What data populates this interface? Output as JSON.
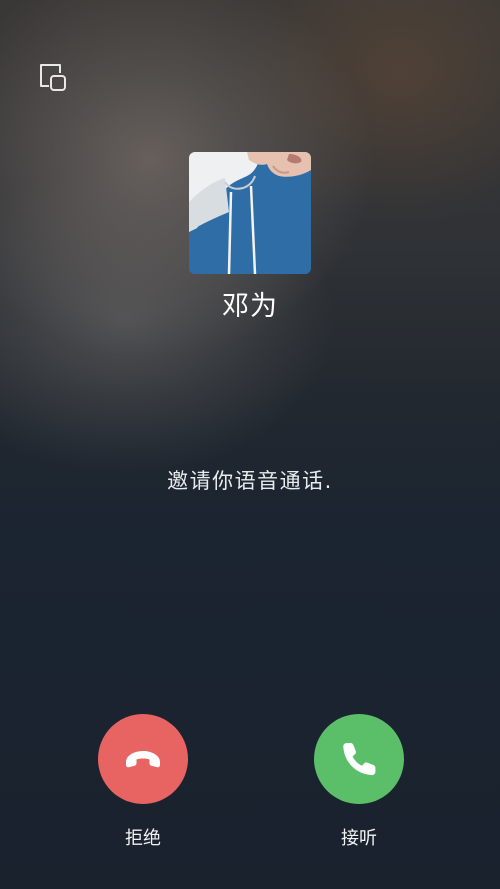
{
  "call": {
    "caller_name": "邓为",
    "status": "邀请你语音通话."
  },
  "actions": {
    "decline_label": "拒绝",
    "accept_label": "接听"
  },
  "icons": {
    "minimize": "minimize-window-icon",
    "decline": "phone-hangup-icon",
    "accept": "phone-icon"
  },
  "colors": {
    "decline": "#e86462",
    "accept": "#5bbf6a",
    "avatar_background": "#2f6da7"
  }
}
